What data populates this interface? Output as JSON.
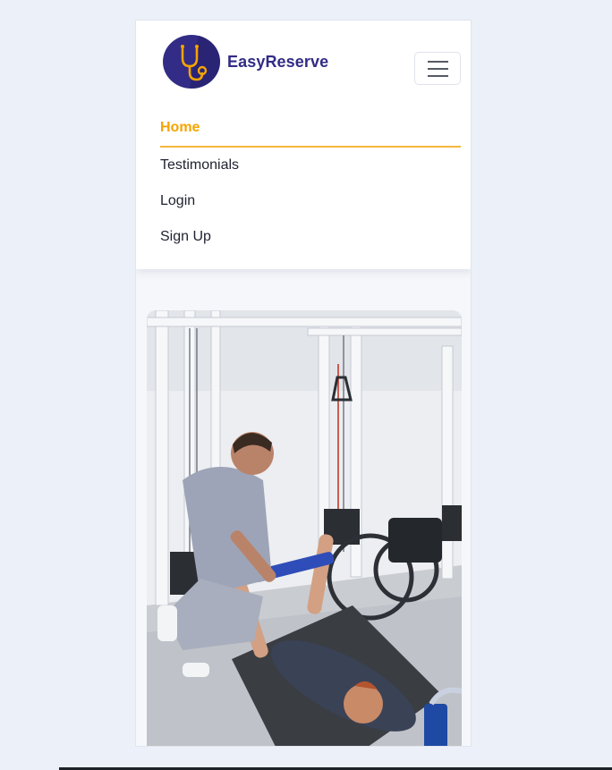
{
  "app": {
    "brand_name": "EasyReserve",
    "logo_icon": "stethoscope-icon"
  },
  "nav": {
    "toggle_icon": "hamburger-menu-icon",
    "links": [
      {
        "label": "Home",
        "active": true
      },
      {
        "label": "Testimonials",
        "active": false
      },
      {
        "label": "Login",
        "active": false
      },
      {
        "label": "Sign Up",
        "active": false
      }
    ]
  },
  "hero": {
    "image_subject": "physiotherapist-with-patient-photo"
  },
  "colors": {
    "brand": "#322c86",
    "accent": "#f6a400",
    "page_bg": "#ecf0f8"
  }
}
